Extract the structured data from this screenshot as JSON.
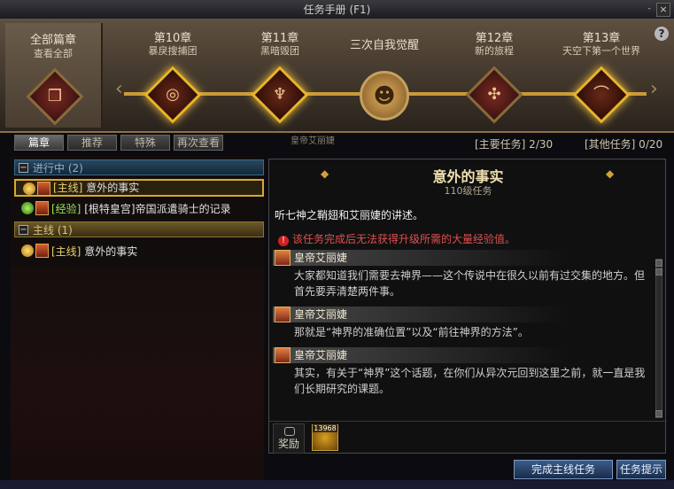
{
  "window": {
    "title": "任务手册 (F1)",
    "close": "×",
    "min": "-"
  },
  "chapters": {
    "all": {
      "name": "全部篇章",
      "sub": "查看全部"
    },
    "items": [
      {
        "name": "第10章",
        "sub": "暴戾搜捕团",
        "icon": "◎"
      },
      {
        "name": "第11章",
        "sub": "黑暗毁团",
        "icon": "♆"
      },
      {
        "name": "三次自我觉醒",
        "sub": "",
        "icon": "☻"
      },
      {
        "name": "第12章",
        "sub": "新的旅程",
        "icon": "✣"
      },
      {
        "name": "第13章",
        "sub": "天空下第一个世界",
        "icon": "⌒"
      }
    ],
    "help": "?"
  },
  "tabs": [
    "篇章",
    "推荐",
    "特殊",
    "再次查看"
  ],
  "header_overlay": "皇帝艾丽婕",
  "counts": {
    "main": "[主要任务] 2/30",
    "other": "[其他任务] 0/20"
  },
  "left": {
    "group1": "进行中 (2)",
    "q1_tag": "[主线]",
    "q1_text": "意外的事实",
    "q2_tag": "[经验]",
    "q2_text": "[根特皇宫]帝国派遣骑士的记录",
    "group2": "主线 (1)",
    "q3_tag": "[主线]",
    "q3_text": "意外的事实"
  },
  "detail": {
    "title": "意外的事实",
    "level": "110级任务",
    "desc": "听七神之鞘翅和艾丽婕的讲述。",
    "warning": "该任务完成后无法获得升级所需的大量经验值。",
    "dialogs": [
      {
        "name": "皇帝艾丽婕",
        "text": "大家都知道我们需要去神界——这个传说中在很久以前有过交集的地方。但首先要弄清楚两件事。"
      },
      {
        "name": "皇帝艾丽婕",
        "text": "那就是“神界的准确位置”以及“前往神界的方法”。"
      },
      {
        "name": "皇帝艾丽婕",
        "text": "其实，有关于“神界”这个话题，在你们从异次元回到这里之前，就一直是我们长期研究的课题。"
      }
    ],
    "reward_label": "奖励",
    "reward_count": "13968"
  },
  "buttons": {
    "complete": "完成主线任务",
    "hint": "任务提示"
  }
}
